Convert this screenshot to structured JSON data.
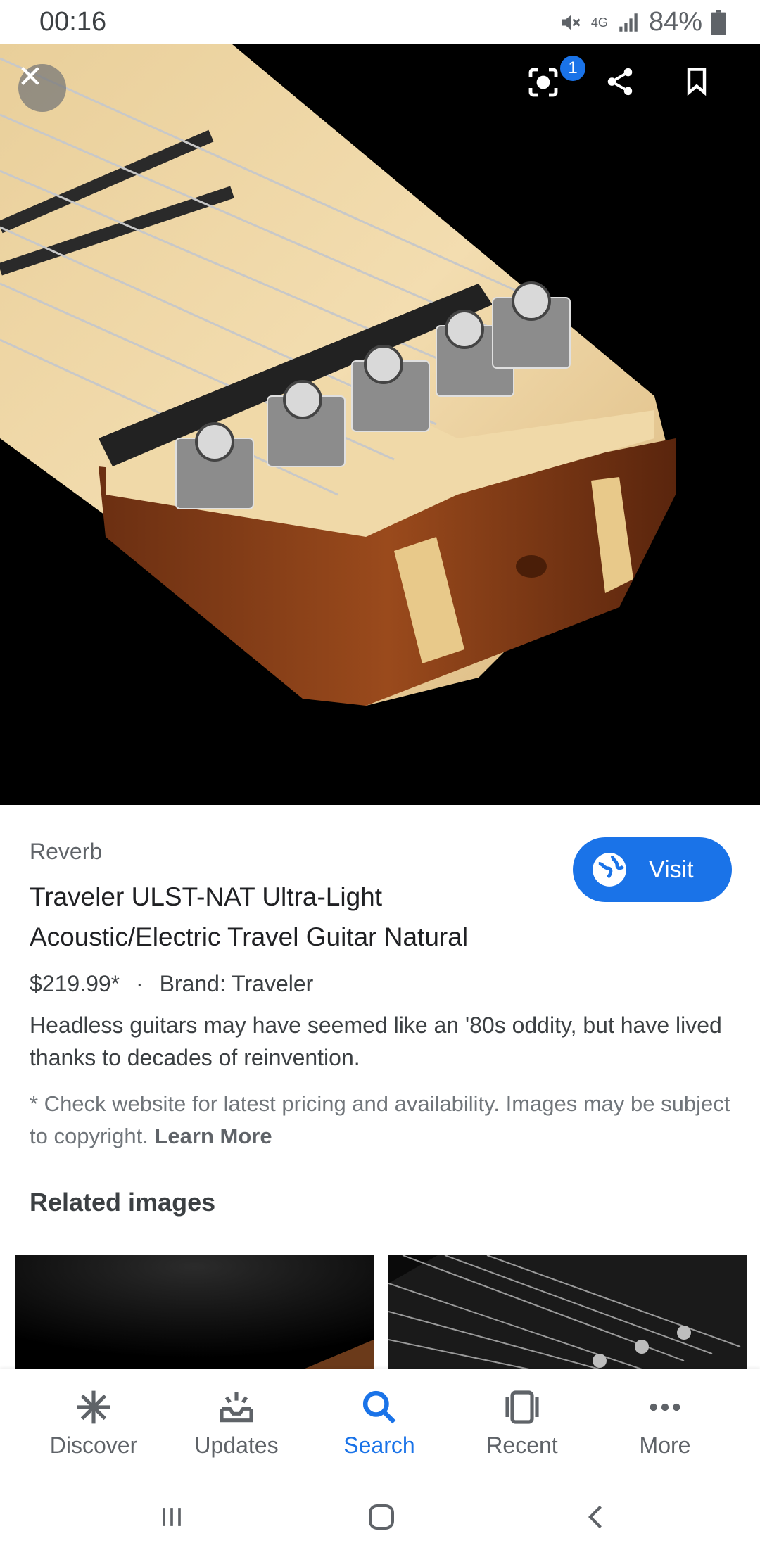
{
  "status": {
    "time": "00:16",
    "network": "4G",
    "battery": "84%"
  },
  "image": {
    "badge_count": "1"
  },
  "result": {
    "source": "Reverb",
    "title": "Traveler ULST-NAT Ultra-Light Acoustic/Electric Travel Guitar Natural",
    "price": "$219.99*",
    "separator": "·",
    "brand": "Brand: Traveler",
    "description": "Headless guitars may have seemed like an '80s oddity, but have lived thanks to decades of reinvention.",
    "disclaimer": "* Check website for latest pricing and availability. Images may be subject to copyright.",
    "learn_more": "Learn More",
    "visit_label": "Visit"
  },
  "related": {
    "heading": "Related images"
  },
  "nav": {
    "items": [
      {
        "label": "Discover",
        "icon": "asterisk-icon"
      },
      {
        "label": "Updates",
        "icon": "inbox-updates-icon"
      },
      {
        "label": "Search",
        "icon": "search-icon"
      },
      {
        "label": "Recent",
        "icon": "recent-cards-icon"
      },
      {
        "label": "More",
        "icon": "more-dots-icon"
      }
    ],
    "active": "Search"
  },
  "colors": {
    "accent": "#1a73e8",
    "text": "#202124",
    "muted": "#5f6368"
  }
}
